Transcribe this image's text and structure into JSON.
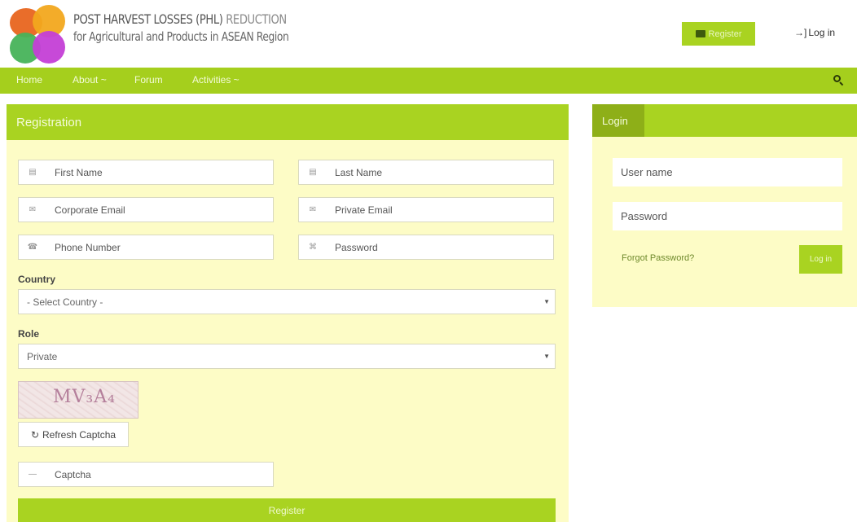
{
  "header": {
    "title_bold": "POST HARVEST LOSSES (PHL)",
    "title_thin": "REDUCTION",
    "subtitle": "for Agricultural  and Products in ASEAN Region",
    "register_label": "Register",
    "login_label": "Log in"
  },
  "nav": {
    "items": [
      {
        "label": "Home"
      },
      {
        "label": "About ~"
      },
      {
        "label": "Forum"
      },
      {
        "label": "Activities ~"
      }
    ],
    "search_icon": "search-icon"
  },
  "registration": {
    "title": "Registration",
    "first_name": "First Name",
    "last_name": "Last Name",
    "corporate_email": "Corporate Email",
    "private_email": "Private Email",
    "phone_number": "Phone Number",
    "password": "Password",
    "country_label": "Country",
    "country_value": "- Select Country -",
    "role_label": "Role",
    "role_value": "Private",
    "captcha_text": "MV₃A₄",
    "refresh_label": "Refresh Captcha",
    "captcha_placeholder": "Captcha",
    "register_button": "Register"
  },
  "login": {
    "title": "Login",
    "username": "User name",
    "password": "Password",
    "forgot": "Forgot Password?",
    "button": "Log in"
  },
  "colors": {
    "accent": "#a9d321",
    "panel_bg": "#fdfcc6"
  }
}
